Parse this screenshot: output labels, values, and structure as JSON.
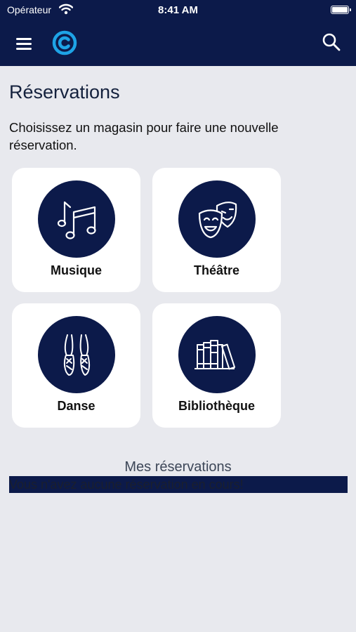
{
  "status_bar": {
    "carrier": "Opérateur",
    "time": "8:41 AM"
  },
  "nav": {
    "menu_icon": "hamburger-menu-icon",
    "logo_icon": "app-logo-c-icon",
    "search_icon": "search-icon",
    "color": "#0c1a4a",
    "logo_color": "#1ea3e6"
  },
  "page": {
    "title": "Réservations",
    "intro": "Choisissez un magasin pour faire une nouvelle réservation."
  },
  "categories": [
    {
      "label": "Musique",
      "icon": "music-notes-icon"
    },
    {
      "label": "Théâtre",
      "icon": "theatre-masks-icon"
    },
    {
      "label": "Danse",
      "icon": "ballet-shoes-icon"
    },
    {
      "label": "Bibliothèque",
      "icon": "books-icon"
    }
  ],
  "reservations": {
    "title": "Mes réservations",
    "empty_message": "Vous n'avez aucune réservation en cours!"
  }
}
